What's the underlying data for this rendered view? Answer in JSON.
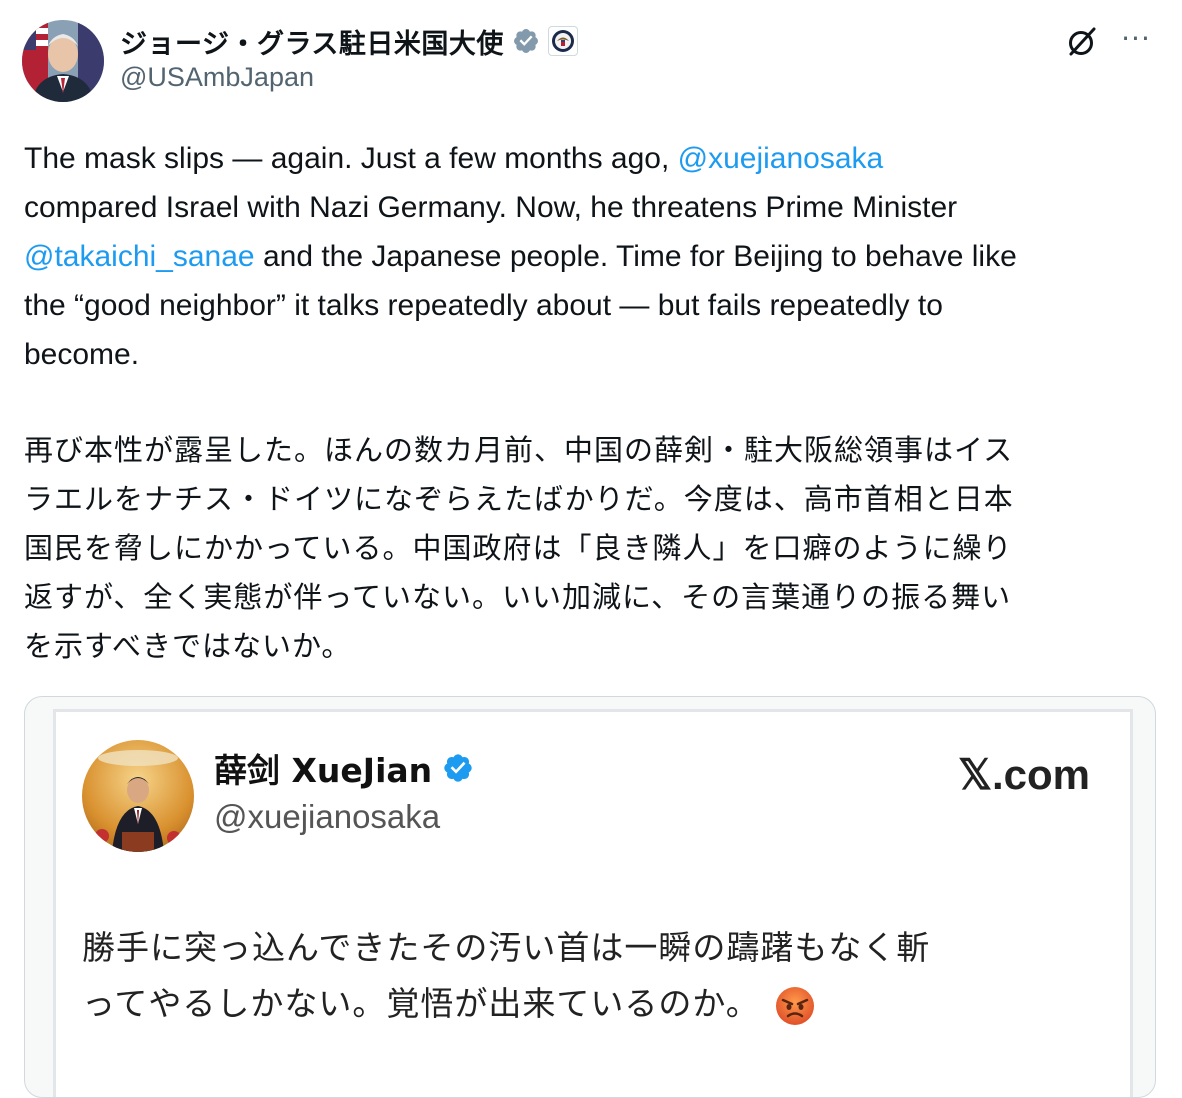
{
  "author": {
    "display_name": "ジョージ・グラス駐日米国大使",
    "handle": "@USAmbJapan",
    "avatar_icon": "avatar",
    "verified_icon": "verified-badge-icon",
    "affiliation_icon": "us-embassy-seal-icon"
  },
  "actions": {
    "grok_icon": "grok-icon",
    "more_icon": "more-icon",
    "more_glyph": "···"
  },
  "body_en": {
    "line1_a": "The mask slips — again. Just a few months ago, ",
    "line1_mention": "@xuejianosaka",
    "line2": "compared Israel with Nazi Germany. Now, he threatens Prime Minister",
    "line3_mention": "@takaichi_sanae",
    "line3_b": " and the Japanese people. Time for Beijing to behave like",
    "line4": "the “good neighbor” it talks repeatedly about — but fails repeatedly to",
    "line5": "become."
  },
  "body_ja": {
    "line1": "再び本性が露呈した。ほんの数カ月前、中国の薛剣・駐大阪総領事はイス",
    "line2": "ラエルをナチス・ドイツになぞらえたばかりだ。今度は、高市首相と日本",
    "line3": "国民を脅しにかかっている。中国政府は「良き隣人」を口癖のように繰り",
    "line4": "返すが、全く実態が伴っていない。いい加減に、その言葉通りの振る舞い",
    "line5": "を示すべきではないか。"
  },
  "quoted_image": {
    "name": "薛剑 XueJian",
    "handle": "@xuejianosaka",
    "site": "𝕏.com",
    "text_line1": "勝手に突っ込んできたその汚い首は一瞬の躊躇もなく斬",
    "text_line2": "ってやるしかない。覚悟が出来ているのか。",
    "emoji": "angry-face-emoji"
  },
  "colors": {
    "link": "#1d9bf0",
    "secondary_text": "#536471",
    "border": "#cfd9de"
  }
}
